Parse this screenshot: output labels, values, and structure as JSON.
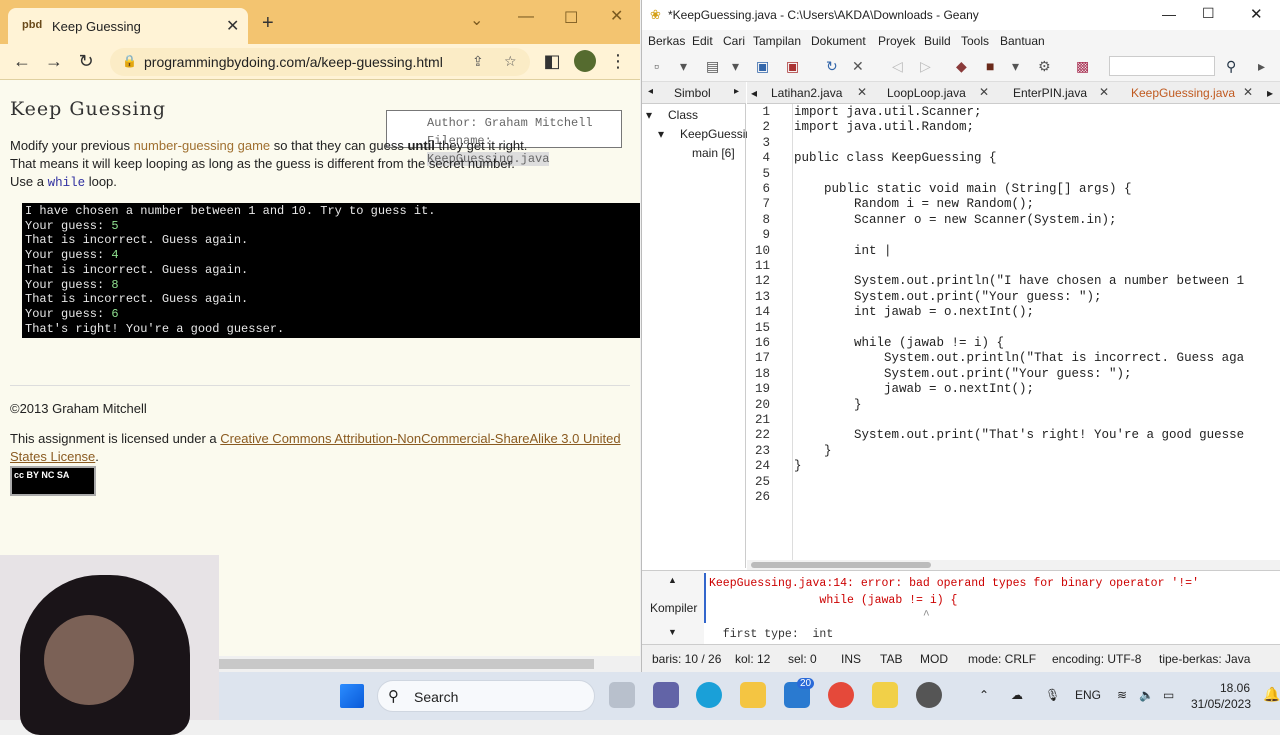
{
  "browser": {
    "tab_title": "Keep Guessing",
    "new_tab": "+",
    "url": "programmingbydoing.com/a/keep-guessing.html",
    "page": {
      "title": "Keep Guessing",
      "author_line": "Author: Graham Mitchell",
      "filename_label": "Filename: ",
      "filename_value": "KeepGuessing.java",
      "desc_1": "Modify your previous ",
      "desc_link": "number-guessing game",
      "desc_2": " so that they can guess ",
      "desc_bold": "until",
      "desc_3": " they get it right. That means it will keep looping as long as the guess is different from the secret number. Use a ",
      "desc_code": "while",
      "desc_4": " loop.",
      "terminal": [
        {
          "text": "I have chosen a number between 1 and 10. Try to guess it.",
          "input": ""
        },
        {
          "text": "Your guess: ",
          "input": "5"
        },
        {
          "text": "That is incorrect. Guess again.",
          "input": ""
        },
        {
          "text": "Your guess: ",
          "input": "4"
        },
        {
          "text": "That is incorrect. Guess again.",
          "input": ""
        },
        {
          "text": "Your guess: ",
          "input": "8"
        },
        {
          "text": "That is incorrect. Guess again.",
          "input": ""
        },
        {
          "text": "Your guess: ",
          "input": "6"
        },
        {
          "text": "That's right! You're a good guesser.",
          "input": ""
        }
      ],
      "copyright": "©2013 Graham Mitchell",
      "license_pre": "This assignment is licensed under a ",
      "license_link": "Creative Commons Attribution-NonCommercial-ShareAlike 3.0 United States License",
      "license_post": ".",
      "cc_badge": "cc BY NC SA"
    }
  },
  "geany": {
    "title": "*KeepGuessing.java - C:\\Users\\AKDA\\Downloads - Geany",
    "menu": [
      "Berkas",
      "Edit",
      "Cari",
      "Tampilan",
      "Dokument",
      "Proyek",
      "Build",
      "Tools",
      "Bantuan"
    ],
    "sidebar_tab": "Simbol",
    "tree": {
      "root": "Class",
      "cls": "KeepGuessin",
      "method": "main [6]"
    },
    "file_tabs": [
      "Latihan2.java",
      "LoopLoop.java",
      "EnterPIN.java",
      "KeepGuessing.java"
    ],
    "code_lines": [
      "import java.util.Scanner;",
      "import java.util.Random;",
      "",
      "public class KeepGuessing {",
      "",
      "    public static void main (String[] args) {",
      "        Random i = new Random();",
      "        Scanner o = new Scanner(System.in);",
      "",
      "        int |",
      "",
      "        System.out.println(\"I have chosen a number between 1",
      "        System.out.print(\"Your guess: \");",
      "        int jawab = o.nextInt();",
      "",
      "        while (jawab != i) {",
      "            System.out.println(\"That is incorrect. Guess aga",
      "            System.out.print(\"Your guess: \");",
      "            jawab = o.nextInt();",
      "        }",
      "",
      "        System.out.print(\"That's right! You're a good guesse",
      "    }",
      "}",
      "",
      ""
    ],
    "compiler_label": "Kompiler",
    "errors": [
      "KeepGuessing.java:14: error: bad operand types for binary operator '!='",
      "                while (jawab != i) {",
      "                               ^",
      "  first type:  int"
    ],
    "status": {
      "line": "baris: 10 / 26",
      "col": "kol: 12",
      "sel": "sel: 0",
      "ins": "INS",
      "tab": "TAB",
      "mod": "MOD",
      "mode": "mode: CRLF",
      "encoding": "encoding: UTF-8",
      "filetype": "tipe-berkas: Java"
    }
  },
  "taskbar": {
    "search": "Search",
    "lang": "ENG",
    "time": "18.06",
    "date": "31/05/2023",
    "badge": "20"
  }
}
